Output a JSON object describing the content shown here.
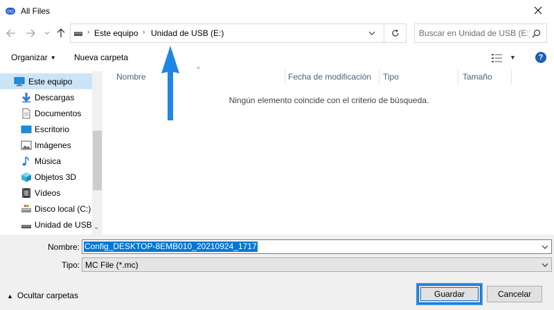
{
  "window": {
    "title": "All Files"
  },
  "address_bar": {
    "parts": [
      "Este equipo",
      "Unidad de USB (E:)"
    ]
  },
  "search": {
    "placeholder": "Buscar en Unidad de USB (E:)"
  },
  "toolbar": {
    "organize_label": "Organizar",
    "new_folder_label": "Nueva carpeta",
    "help_label": "?"
  },
  "sidebar": {
    "items": [
      {
        "label": "Este equipo",
        "icon": "computer-icon",
        "selected": true
      },
      {
        "label": "Descargas",
        "icon": "download-icon"
      },
      {
        "label": "Documentos",
        "icon": "document-icon"
      },
      {
        "label": "Escritorio",
        "icon": "desktop-icon"
      },
      {
        "label": "Imágenes",
        "icon": "pictures-icon"
      },
      {
        "label": "Música",
        "icon": "music-icon"
      },
      {
        "label": "Objetos 3D",
        "icon": "cube-icon"
      },
      {
        "label": "Vídeos",
        "icon": "video-icon"
      },
      {
        "label": "Disco local (C:)",
        "icon": "disk-icon"
      },
      {
        "label": "Unidad de USB (",
        "icon": "usb-drive-icon"
      }
    ]
  },
  "file_list": {
    "columns": [
      "Nombre",
      "Fecha de modificación",
      "Tipo",
      "Tamaño"
    ],
    "empty_message": "Ningún elemento coincide con el criterio de búsqueda."
  },
  "save_form": {
    "name_label": "Nombre:",
    "name_value": "Config_DESKTOP-8EMB010_20210924_1717",
    "type_label": "Tipo:",
    "type_value": "MC File (*.mc)"
  },
  "footer": {
    "hide_folders_label": "Ocultar carpetas",
    "save_button": "Guardar",
    "cancel_button": "Cancelar"
  },
  "colors": {
    "accent": "#0078d7",
    "annotation_arrow": "#1f86e6",
    "selection": "#cce4f7"
  }
}
